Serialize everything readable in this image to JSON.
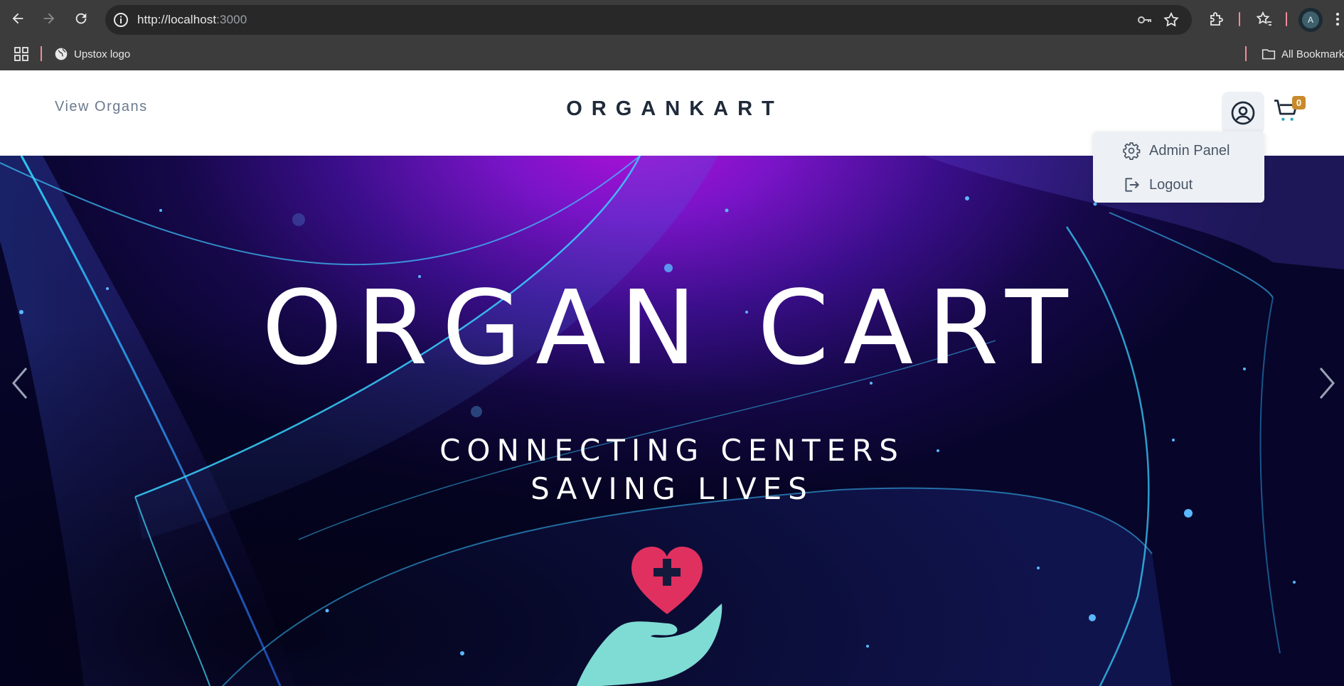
{
  "browser": {
    "url_host": "http://localhost",
    "url_port": ":3000",
    "avatar_letter": "A",
    "bookmarks": [
      {
        "label": "Upstox logo",
        "icon": "globe-icon"
      }
    ],
    "all_bookmarks_label": "All Bookmarks"
  },
  "header": {
    "nav_link": "View Organs",
    "brand": "ORGANKART",
    "cart_count": "0",
    "user_icon": "user-circle-icon",
    "cart_icon": "cart-icon"
  },
  "user_menu": {
    "items": [
      {
        "label": "Admin Panel",
        "icon": "gear-icon"
      },
      {
        "label": "Logout",
        "icon": "logout-icon"
      }
    ]
  },
  "hero": {
    "title": "ORGAN CART",
    "line1": "CONNECTING CENTERS",
    "line2": "SAVING LIVES",
    "logo": "heart-hand-icon"
  },
  "colors": {
    "chrome_bg": "#3c3c3c",
    "header_text": "#1f2a3a",
    "badge": "#c98a2a",
    "heart": "#e0305f",
    "hand": "#7fdcd4",
    "hero_top": "#b010d8",
    "hero_bottom": "#07052a"
  }
}
